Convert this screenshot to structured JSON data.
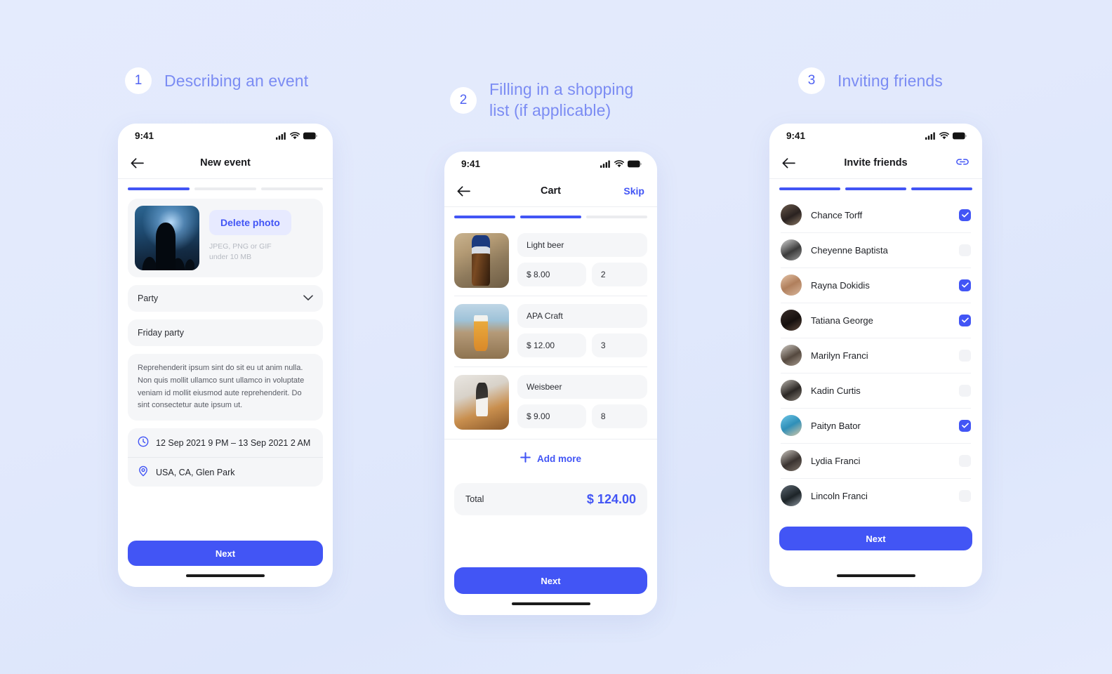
{
  "theme": {
    "accent": "#4255F5",
    "accent_soft": "#7B8CF3",
    "background": "#E3EAFD",
    "field_bg": "#F5F6F8"
  },
  "steps": [
    {
      "number": "1",
      "title": "Describing an event"
    },
    {
      "number": "2",
      "title": "Filling in a shopping\nlist (if applicable)"
    },
    {
      "number": "3",
      "title": "Inviting friends"
    }
  ],
  "screen1": {
    "statusbar": {
      "time": "9:41"
    },
    "nav": {
      "title": "New event",
      "back_icon": "back-arrow-icon"
    },
    "progress": {
      "total": 3,
      "filled": 1
    },
    "photo": {
      "delete_label": "Delete photo",
      "hint_line1": "JPEG, PNG or GIF",
      "hint_line2": "under 10 MB"
    },
    "category": {
      "value": "Party",
      "chevron_icon": "chevron-down-icon"
    },
    "event_name": {
      "value": "Friday party"
    },
    "description": {
      "value": "Reprehenderit ipsum sint do sit eu ut anim nulla. Non quis mollit ullamco sunt ullamco in voluptate veniam id mollit eiusmod aute reprehenderit. Do sint consectetur aute ipsum ut."
    },
    "datetime": {
      "icon": "clock-icon",
      "value": "12 Sep 2021 9 PM – 13 Sep 2021 2 AM"
    },
    "location": {
      "icon": "location-pin-icon",
      "value": "USA, CA, Glen Park"
    },
    "next_label": "Next"
  },
  "screen2": {
    "statusbar": {
      "time": "9:41"
    },
    "nav": {
      "title": "Cart",
      "skip_label": "Skip",
      "back_icon": "back-arrow-icon"
    },
    "progress": {
      "total": 3,
      "filled": 2
    },
    "items": [
      {
        "name": "Light beer",
        "price": "$ 8.00",
        "qty": "2",
        "image": "beer-bottle-bavaria-photo"
      },
      {
        "name": "APA Craft",
        "price": "$ 12.00",
        "qty": "3",
        "image": "beer-glass-seaside-photo"
      },
      {
        "name": "Weisbeer",
        "price": "$ 9.00",
        "qty": "8",
        "image": "beer-bottle-cheers-photo"
      }
    ],
    "add_more_label": "Add more",
    "total_label": "Total",
    "total_value": "$ 124.00",
    "next_label": "Next"
  },
  "screen3": {
    "statusbar": {
      "time": "9:41"
    },
    "nav": {
      "title": "Invite friends",
      "back_icon": "back-arrow-icon",
      "link_icon": "link-icon"
    },
    "progress": {
      "total": 3,
      "filled": 3
    },
    "friends": [
      {
        "name": "Chance Torff",
        "checked": true
      },
      {
        "name": "Cheyenne Baptista",
        "checked": false
      },
      {
        "name": "Rayna Dokidis",
        "checked": true
      },
      {
        "name": "Tatiana George",
        "checked": true
      },
      {
        "name": "Marilyn Franci",
        "checked": false
      },
      {
        "name": "Kadin Curtis",
        "checked": false
      },
      {
        "name": "Paityn Bator",
        "checked": true
      },
      {
        "name": "Lydia Franci",
        "checked": false
      },
      {
        "name": "Lincoln Franci",
        "checked": false
      }
    ],
    "next_label": "Next"
  }
}
